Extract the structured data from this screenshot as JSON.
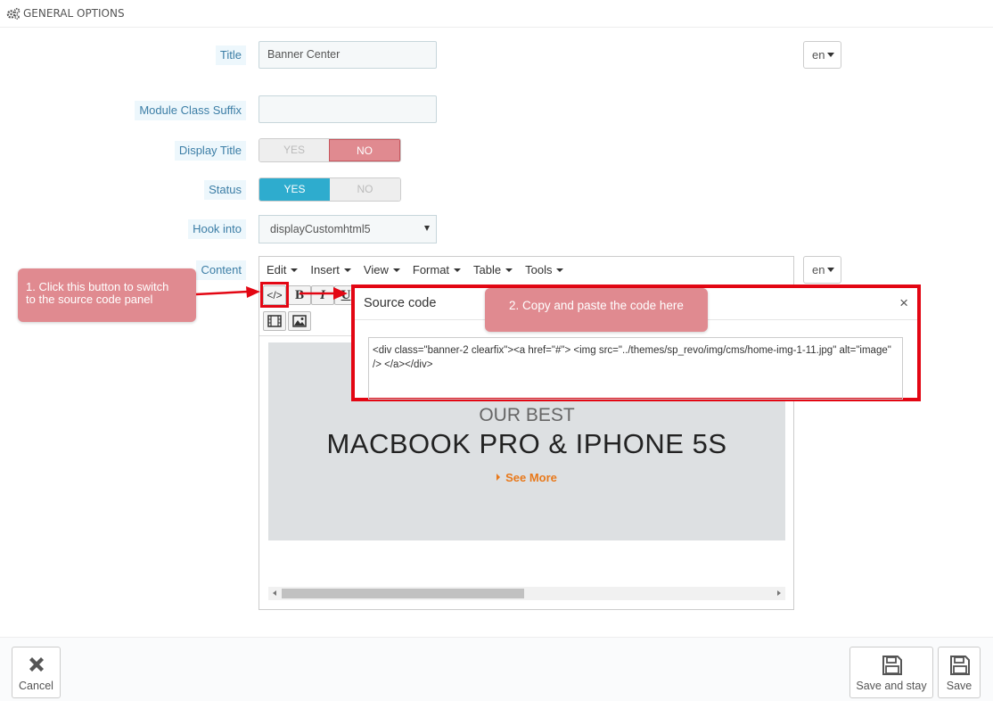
{
  "panel": {
    "heading": "GENERAL OPTIONS",
    "icon": "gears-icon"
  },
  "form": {
    "title": {
      "label": "Title",
      "value": "Banner Center",
      "lang": "en"
    },
    "module_class_suffix": {
      "label": "Module Class Suffix",
      "value": ""
    },
    "display_title": {
      "label": "Display Title",
      "yes": "YES",
      "no": "NO",
      "selected": "NO"
    },
    "status": {
      "label": "Status",
      "yes": "YES",
      "no": "NO",
      "selected": "YES"
    },
    "hook_into": {
      "label": "Hook into",
      "value": "displayCustomhtml5"
    },
    "content": {
      "label": "Content",
      "lang": "en"
    }
  },
  "editor": {
    "menu": [
      "Edit",
      "Insert",
      "View",
      "Format",
      "Table",
      "Tools"
    ],
    "toolbar": {
      "source_code": "</>",
      "bold": "B",
      "italic": "I",
      "underline": "U"
    },
    "banner": {
      "line1": "OUR BEST",
      "line2": "MACBOOK PRO & IPHONE 5S",
      "link": "See More"
    }
  },
  "modal": {
    "title": "Source code",
    "close": "×",
    "code": "<div class=\"banner-2 clearfix\"><a href=\"#\"> <img src=\"../themes/sp_revo/img/cms/home-img-1-11.jpg\" alt=\"image\" /> </a></div>"
  },
  "callouts": {
    "step1": [
      "1. Click this button to switch",
      "to the source code panel"
    ],
    "step2": "2. Copy and paste the code here"
  },
  "footer": {
    "cancel": "Cancel",
    "save_and_stay": "Save and stay",
    "save": "Save"
  },
  "colors": {
    "accent_blue": "#2eacce",
    "no_red": "#e08a90",
    "highlight_red": "#e30613",
    "label_bg": "#edf7fc",
    "link_orange": "#e8791b"
  }
}
